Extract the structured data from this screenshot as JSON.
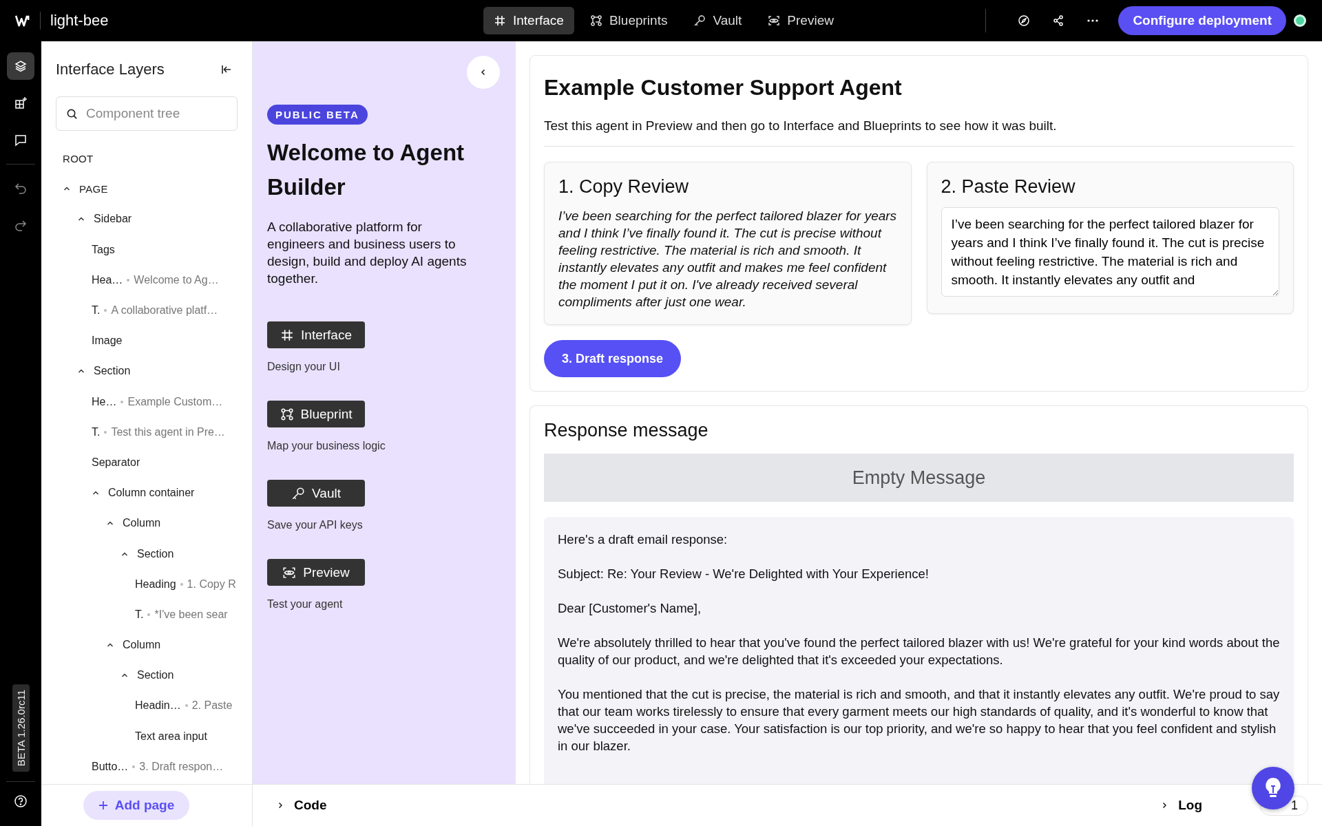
{
  "app": {
    "name": "light-bee"
  },
  "nav_tabs": [
    {
      "kind": "interface",
      "label": "Interface",
      "selected": true
    },
    {
      "kind": "blueprint",
      "label": "Blueprints",
      "selected": false
    },
    {
      "kind": "vault",
      "label": "Vault",
      "selected": false
    },
    {
      "kind": "preview",
      "label": "Preview",
      "selected": false
    }
  ],
  "deploy_button": "Configure deployment",
  "rail": [
    {
      "kind": "layers",
      "selected": true,
      "disabled": false
    },
    {
      "kind": "add",
      "selected": false,
      "disabled": false
    },
    {
      "kind": "comment",
      "selected": false,
      "disabled": false
    },
    {
      "kind": "undo",
      "selected": false,
      "disabled": true
    },
    {
      "kind": "redo",
      "selected": false,
      "disabled": true
    }
  ],
  "version_badge": "BETA 1.26.0rc11",
  "layers": {
    "title": "Interface Layers",
    "search": {
      "placeholder": "Component tree"
    },
    "tree": [
      {
        "label": "ROOT"
      },
      {
        "label": "PAGE",
        "expanded": true,
        "children": [
          {
            "label": "Sidebar",
            "expanded": true,
            "children": [
              {
                "label": "Tags"
              },
              {
                "label": "Hea…",
                "detail": "Welcome to Ag…"
              },
              {
                "label": "T.",
                "detail": "A collaborative platf…"
              },
              {
                "label": "Image"
              }
            ]
          },
          {
            "label": "Section",
            "expanded": true,
            "children": [
              {
                "label": "He…",
                "detail": "Example Custom…"
              },
              {
                "label": "T.",
                "detail": "Test this agent in Pre…"
              },
              {
                "label": "Separator"
              },
              {
                "label": "Column container",
                "expanded": true,
                "children": [
                  {
                    "label": "Column",
                    "expanded": true,
                    "children": [
                      {
                        "label": "Section",
                        "expanded": true,
                        "children": [
                          {
                            "label": "Heading",
                            "detail": "1. Copy R"
                          },
                          {
                            "label": "T.",
                            "detail": "*I've been sear"
                          }
                        ]
                      }
                    ]
                  },
                  {
                    "label": "Column",
                    "expanded": true,
                    "children": [
                      {
                        "label": "Section",
                        "expanded": true,
                        "children": [
                          {
                            "label": "Headin…",
                            "detail": "2. Paste"
                          },
                          {
                            "label": "Text area input"
                          }
                        ]
                      }
                    ]
                  }
                ]
              },
              {
                "label": "Butto…",
                "detail": "3. Draft respon…"
              }
            ]
          }
        ]
      }
    ],
    "add_page": "Add page"
  },
  "welcome": {
    "badge": "PUBLIC BETA",
    "title": "Welcome to Agent Builder",
    "description": "A collaborative platform for engineers and business users to design, build and deploy AI agents together.",
    "features": [
      {
        "kind": "interface",
        "label": "Interface",
        "caption": "Design your UI"
      },
      {
        "kind": "blueprint",
        "label": "Blueprint",
        "caption": "Map your business logic"
      },
      {
        "kind": "vault",
        "label": "Vault",
        "caption": "Save your API keys"
      },
      {
        "kind": "preview",
        "label": "Preview",
        "caption": "Test your agent"
      }
    ]
  },
  "agent": {
    "title": "Example Customer Support Agent",
    "subtitle": "Test this agent in Preview and then go to Interface and Blueprints to see how it was built.",
    "copy_review": {
      "title": "1. Copy Review",
      "text": "I’ve been searching for the perfect tailored blazer for years and I think I’ve finally found it. The cut is precise without feeling restrictive. The material is rich and smooth. It instantly elevates any outfit and makes me feel confident the moment I put it on. I've already received several compliments after just one wear."
    },
    "paste_review": {
      "title": "2. Paste Review",
      "value": "I’ve been searching for the perfect tailored blazer for years and I think I’ve finally found it. The cut is precise without feeling restrictive. The material is rich and smooth. It instantly elevates any outfit and"
    },
    "draft_button": "3. Draft response"
  },
  "response": {
    "title": "Response message",
    "status": "Empty Message",
    "paragraphs": [
      "Here's a draft email response:",
      "Subject: Re: Your Review - We're Delighted with Your Experience!",
      "Dear [Customer's Name],",
      "We're absolutely thrilled to hear that you've found the perfect tailored blazer with us! We're grateful for your kind words about the quality of our product, and we're delighted that it's exceeded your expectations.",
      "You mentioned that the cut is precise, the material is rich and smooth, and that it instantly elevates any outfit. We're proud to say that our team works tirelessly to ensure that every garment meets our high standards of quality, and it's wonderful to know that we've succeeded in your case. Your satisfaction is our top priority, and we're so happy to hear that you feel confident and stylish in our blazer."
    ]
  },
  "bottom_bar": {
    "code": "Code",
    "log": "Log",
    "count": "1"
  }
}
